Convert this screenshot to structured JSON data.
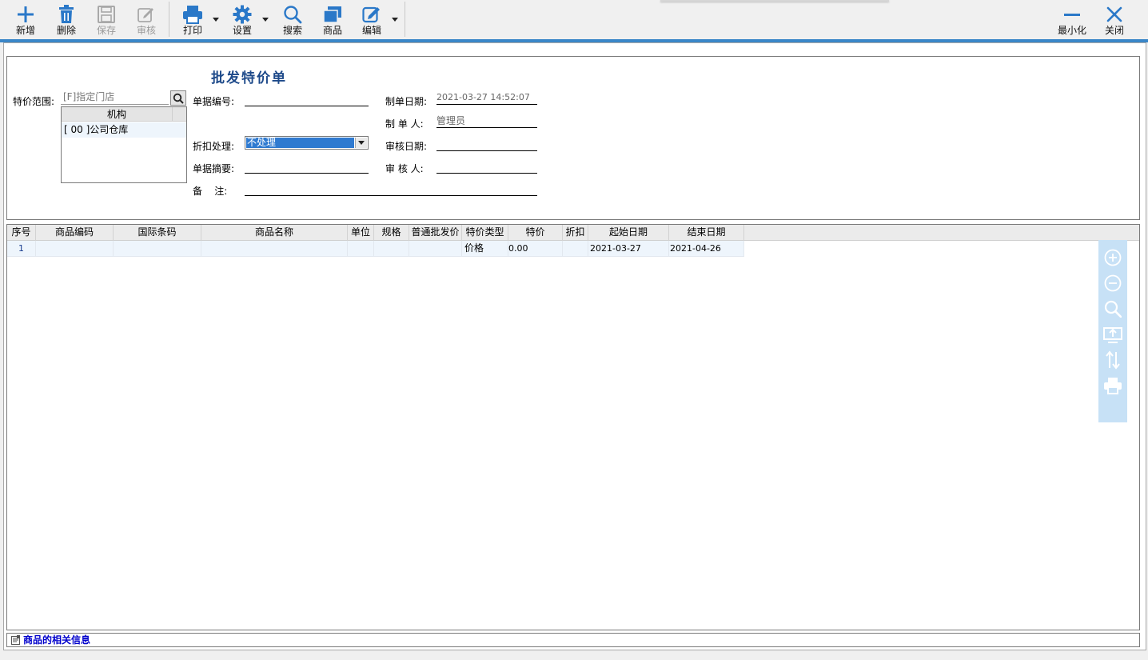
{
  "toolbar": {
    "new": "新增",
    "delete": "删除",
    "save": "保存",
    "audit": "审核",
    "print": "打印",
    "settings": "设置",
    "search": "搜索",
    "goods": "商品",
    "edit": "编辑",
    "minimize": "最小化",
    "close": "关闭"
  },
  "colors": {
    "accent": "#2f7ad0",
    "toolbar_icon": "#2a78c8",
    "title": "#1e4a8a",
    "selected_row": "#eef5fc",
    "side_panel": "#c7e1f6"
  },
  "form": {
    "title": "批发特价单",
    "scope_label": "特价范围:",
    "scope_value": "[F]指定门店",
    "org_header": "机构",
    "org_row": "[ 00 ]公司仓库",
    "doc_no_label": "单据编号:",
    "doc_no_value": "",
    "create_date_label": "制单日期:",
    "create_date_value": "2021-03-27 14:52:07",
    "creator_label": "制 单 人:",
    "creator_value": "管理员",
    "discount_label": "折扣处理:",
    "discount_value": "不处理",
    "audit_date_label": "审核日期:",
    "audit_date_value": "",
    "summary_label": "单据摘要:",
    "summary_value": "",
    "auditor_label": "审 核 人:",
    "auditor_value": "",
    "remark_label": "备    注:",
    "remark_value": ""
  },
  "grid": {
    "columns": [
      "序号",
      "商品编码",
      "国际条码",
      "商品名称",
      "单位",
      "规格",
      "普通批发价",
      "特价类型",
      "特价",
      "折扣",
      "起始日期",
      "结束日期"
    ],
    "rows": [
      {
        "seq": "1",
        "code": "",
        "barcode": "",
        "name": "",
        "unit": "",
        "spec": "",
        "wholesale_price": "",
        "special_type": "价格",
        "special_price": "0.00",
        "discount": "",
        "start_date": "2021-03-27",
        "end_date": "2021-04-26"
      }
    ]
  },
  "side_tools": [
    "zoom-in-icon",
    "zoom-out-icon",
    "search-icon",
    "export-icon",
    "sort-icon",
    "print-icon"
  ],
  "infobar": {
    "text": "商品的相关信息"
  }
}
